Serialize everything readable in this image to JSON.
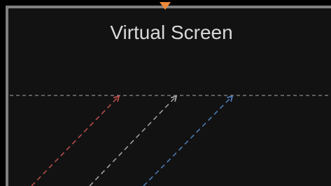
{
  "virtual_screen": {
    "title": "Virtual Screen",
    "background_color": "#121212",
    "border_color": "#808080"
  },
  "marker": {
    "color": "#f0883a"
  },
  "guide_line": {
    "color": "#8c8c8c",
    "style": "dashed"
  },
  "rays": [
    {
      "name": "red-ray",
      "color": "#c0504d",
      "style": "dashed"
    },
    {
      "name": "gray-ray",
      "color": "#a6a6a6",
      "style": "dashed"
    },
    {
      "name": "blue-ray",
      "color": "#4f81bd",
      "style": "dashed"
    }
  ]
}
